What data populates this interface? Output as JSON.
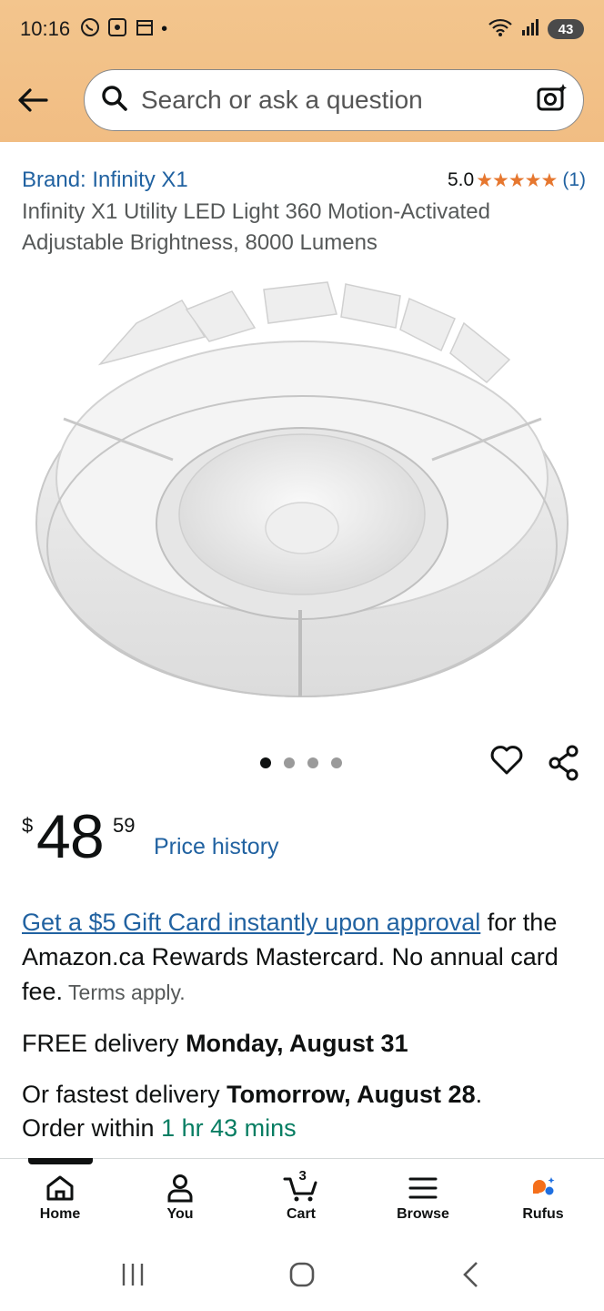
{
  "status_bar": {
    "time": "10:16",
    "battery": "43"
  },
  "search": {
    "placeholder": "Search or ask a question"
  },
  "product": {
    "brand": "Brand: Infinity X1",
    "rating_value": "5.0",
    "rating_stars": "★★★★★",
    "rating_count": "(1)",
    "title": "Infinity X1 Utility LED Light 360 Motion-Activated Adjustable Brightness, 8000 Lumens",
    "image_count": 4,
    "image_index": 1
  },
  "price": {
    "symbol": "$",
    "whole": "48",
    "fraction": "59",
    "history_label": "Price history"
  },
  "promo": {
    "link": "Get a $5 Gift Card instantly upon approval",
    "text": " for the Amazon.ca Rewards Mastercard. No annual card fee.",
    "terms": " Terms apply."
  },
  "delivery": {
    "prefix": "FREE delivery ",
    "date": "Monday, August 31"
  },
  "fastest": {
    "prefix": "Or fastest delivery ",
    "date": "Tomorrow, August 28",
    "suffix": ".",
    "order_prefix": "Order within ",
    "countdown": "1 hr 43 mins"
  },
  "bottom_nav": {
    "home": "Home",
    "you": "You",
    "cart": "Cart",
    "cart_count": "3",
    "browse": "Browse",
    "rufus": "Rufus"
  },
  "colors": {
    "header": "#f3c58d",
    "link": "#2162a1",
    "star": "#e6772f",
    "green": "#067d62"
  }
}
